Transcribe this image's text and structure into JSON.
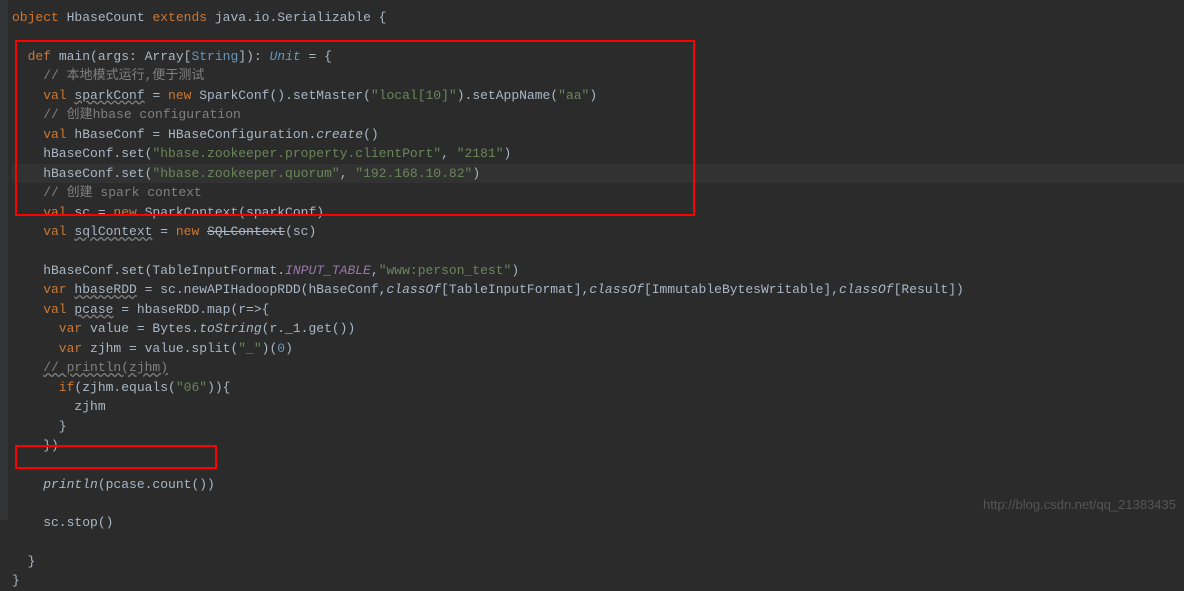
{
  "code": {
    "line1_p1": "object",
    "line1_p2": " HbaseCount ",
    "line1_p3": "extends",
    "line1_p4": " java.io.Serializable {",
    "blank": "",
    "line3_p1": "  def",
    "line3_p2": " main(args: Array[",
    "line3_p3": "String",
    "line3_p4": "]): ",
    "line3_p5": "Unit",
    "line3_p6": " = {",
    "line4": "    // 本地模式运行,便于测试",
    "line5_p1": "    val",
    "line5_p2": " ",
    "line5_p3": "sparkConf",
    "line5_p4": " = ",
    "line5_p5": "new",
    "line5_p6": " SparkConf().setMaster(",
    "line5_p7": "\"local[10]\"",
    "line5_p8": ").setAppName(",
    "line5_p9": "\"aa\"",
    "line5_p10": ")",
    "line6": "    // 创建hbase configuration",
    "line7_p1": "    val",
    "line7_p2": " hBaseConf = HBaseConfiguration.",
    "line7_p3": "create",
    "line7_p4": "()",
    "line8_p1": "    hBaseConf.set(",
    "line8_p2": "\"hbase.zookeeper.property.clientPort\"",
    "line8_p3": ", ",
    "line8_p4": "\"2181\"",
    "line8_p5": ")",
    "line9_p1": "    hBaseConf.set(",
    "line9_p2": "\"hbase.zookeeper.quorum\"",
    "line9_p3": ", ",
    "line9_p4": "\"192.168.10.82\"",
    "line9_p5": ")",
    "line10": "    // 创建 spark context",
    "line11_p1": "    val",
    "line11_p2": " sc = ",
    "line11_p3": "new",
    "line11_p4": " SparkContext(sparkConf)",
    "line12_p1": "    val",
    "line12_p2": " ",
    "line12_p3": "sqlContext",
    "line12_p4": " = ",
    "line12_p5": "new",
    "line12_p6": " ",
    "line12_p7": "SQLContext",
    "line12_p8": "(sc)",
    "line14_p1": "    hBaseConf.set(TableInputFormat.",
    "line14_p2": "INPUT_TABLE",
    "line14_p3": ",",
    "line14_p4": "\"www:person_test\"",
    "line14_p5": ")",
    "line15_p1": "    var",
    "line15_p2": " ",
    "line15_p3": "hbaseRDD",
    "line15_p4": " = sc.newAPIHadoopRDD(hBaseConf,",
    "line15_p5": "classOf",
    "line15_p6": "[TableInputFormat],",
    "line15_p7": "classOf",
    "line15_p8": "[ImmutableBytesWritable],",
    "line15_p9": "classOf",
    "line15_p10": "[Result])",
    "line16_p1": "    val",
    "line16_p2": " ",
    "line16_p3": "pcase",
    "line16_p4": " = hbaseRDD.map(r=>{",
    "line17_p1": "      var",
    "line17_p2": " value = Bytes.",
    "line17_p3": "toString",
    "line17_p4": "(r._1.get())",
    "line18_p1": "      var",
    "line18_p2": " zjhm = value.split(",
    "line18_p3": "\"_\"",
    "line18_p4": ")(",
    "line18_p5": "0",
    "line18_p6": ")",
    "line19_p1": "    ",
    "line19_p2": "// println(zjhm)",
    "line20_p1": "      if",
    "line20_p2": "(zjhm.equals(",
    "line20_p3": "\"06\"",
    "line20_p4": ")){",
    "line21": "        zjhm",
    "line22": "      }",
    "line23": "    })",
    "line25_p1": "    ",
    "line25_p2": "println",
    "line25_p3": "(pcase.count())",
    "line27": "    sc.stop()",
    "line29": "  }",
    "line30": "}"
  },
  "watermark": "http://blog.csdn.net/qq_21383435"
}
